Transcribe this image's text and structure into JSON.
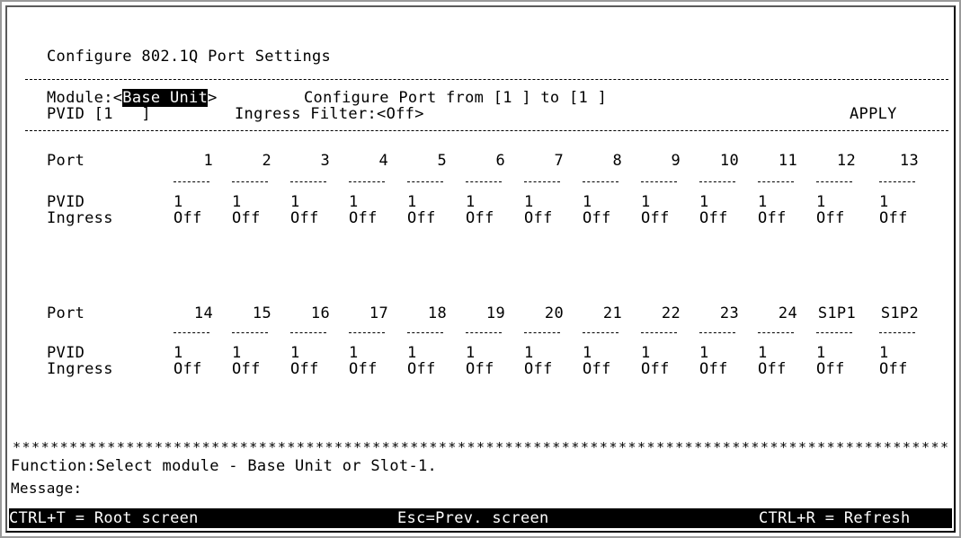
{
  "title": "Configure 802.1Q Port Settings",
  "module_label": "Module:",
  "module_value": "Base Unit",
  "configure_port_label": "Configure Port from [",
  "from_value": "1",
  "to_label": "] to [",
  "to_value": "1",
  "configure_port_end": "]",
  "pvid_label": "PVID [",
  "pvid_value": "1",
  "pvid_end": "]",
  "ingress_filter_label": "Ingress Filter:",
  "ingress_filter_value": "Off",
  "apply_label": "APPLY",
  "row_labels": {
    "port": "Port",
    "pvid": "PVID",
    "ingress": "Ingress"
  },
  "group1": {
    "ports": [
      "1",
      "2",
      "3",
      "4",
      "5",
      "6",
      "7",
      "8",
      "9",
      "10",
      "11",
      "12",
      "13"
    ],
    "pvid": [
      "1",
      "1",
      "1",
      "1",
      "1",
      "1",
      "1",
      "1",
      "1",
      "1",
      "1",
      "1",
      "1"
    ],
    "ingress": [
      "Off",
      "Off",
      "Off",
      "Off",
      "Off",
      "Off",
      "Off",
      "Off",
      "Off",
      "Off",
      "Off",
      "Off",
      "Off"
    ]
  },
  "group2": {
    "ports": [
      "14",
      "15",
      "16",
      "17",
      "18",
      "19",
      "20",
      "21",
      "22",
      "23",
      "24",
      "S1P1",
      "S1P2"
    ],
    "pvid": [
      "1",
      "1",
      "1",
      "1",
      "1",
      "1",
      "1",
      "1",
      "1",
      "1",
      "1",
      "1",
      "1"
    ],
    "ingress": [
      "Off",
      "Off",
      "Off",
      "Off",
      "Off",
      "Off",
      "Off",
      "Off",
      "Off",
      "Off",
      "Off",
      "Off",
      "Off"
    ]
  },
  "function_text": "Function:Select module - Base Unit or Slot-1.",
  "message_label": "Message:",
  "footer": {
    "root": "CTRL+T = Root screen",
    "prev": "Esc=Prev. screen",
    "refresh": "CTRL+R = Refresh"
  }
}
